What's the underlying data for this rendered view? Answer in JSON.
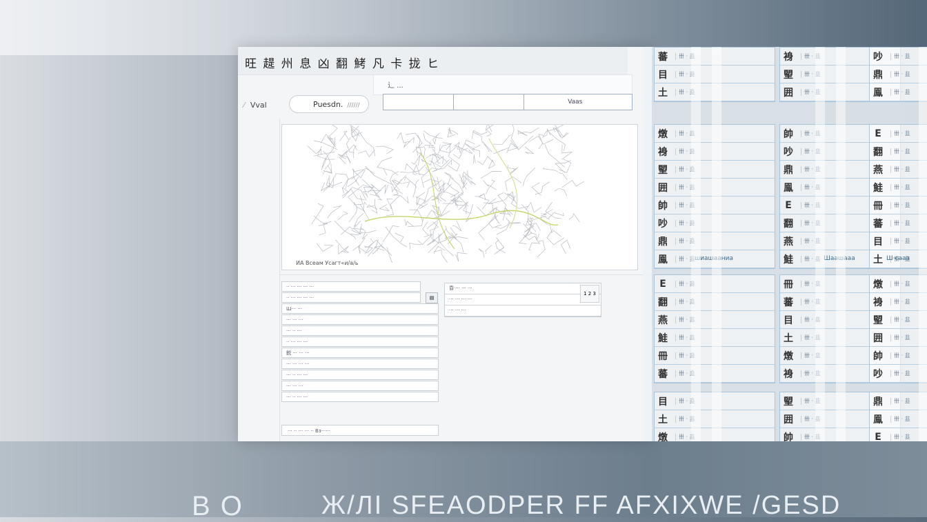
{
  "window": {
    "title": "旺 趧 州 息 凶 翻  鮳 凡 卡 拢 ヒ",
    "sub_label": "辶 ...",
    "nav_label": "Vval",
    "search": {
      "value": "Puesdn.",
      "placeholder": "//////"
    },
    "tab_value": "Vaas",
    "map_caption": "ИА Всеам Усагт«и/а/ь",
    "form_rows": [
      "·· ··· ··· ··· ···",
      "·· ··· ··· ··· ···",
      "Ш··· ···",
      "··· ··· ···",
      "··· ·· ···",
      "·· ··· ··· ···",
      "鋭 ··· ··· ···",
      "··· ··· ··· ···",
      "··· ·· ··· ···",
      "··· ··· ···",
      "··· ·· ··· ···"
    ],
    "form_footer": "··· ·· ··· ··· ·· Вз······",
    "mini_rows": [
      "昏 ··· ··· ···",
      "··· ··· ··· ···",
      "··· ··· ···"
    ],
    "mini_cell": "1 2 3"
  },
  "right_panel": {
    "captions": [
      "шиашааниа",
      "Шаашааа",
      "Ш·сааа"
    ],
    "icons": [
      "蕃",
      "目",
      "土",
      "燉",
      "裑",
      "朢",
      "囲",
      "帥",
      "吵",
      "鼎",
      "鳯",
      "E",
      "翻",
      "燕",
      "鮭",
      "冊"
    ]
  },
  "bottom_text": {
    "left": "B O",
    "right": "Ж/ЛІ SFEAODPER FF  AFXIXWE /GESD"
  }
}
